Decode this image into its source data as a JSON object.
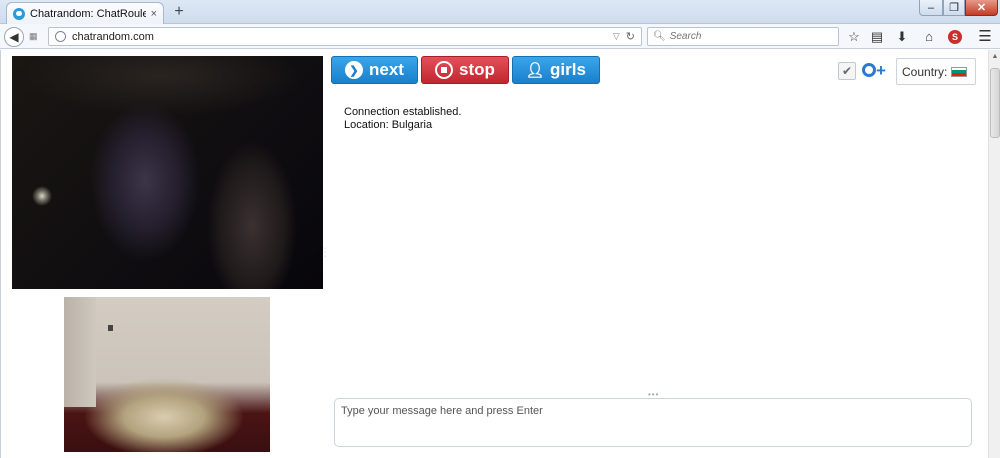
{
  "browser": {
    "tab_title": "Chatrandom: ChatRoulette...",
    "tab_close": "×",
    "new_tab": "+",
    "url": "chatrandom.com",
    "search_placeholder": "Search",
    "window_min": "–",
    "window_max": "❐",
    "window_close": "✕"
  },
  "controls": {
    "next_label": "next",
    "stop_label": "stop",
    "girls_label": "girls",
    "country_label": "Country:",
    "country_flag_colors": [
      "#ffffff",
      "#00966e",
      "#d62612"
    ]
  },
  "chat": {
    "messages": [
      "Connection established.",
      "Location: Bulgaria"
    ],
    "input_placeholder": "Type your message here and press Enter"
  },
  "colors": {
    "next": "#1a7fcc",
    "stop": "#c0262f",
    "girls": "#1a7fcc"
  }
}
